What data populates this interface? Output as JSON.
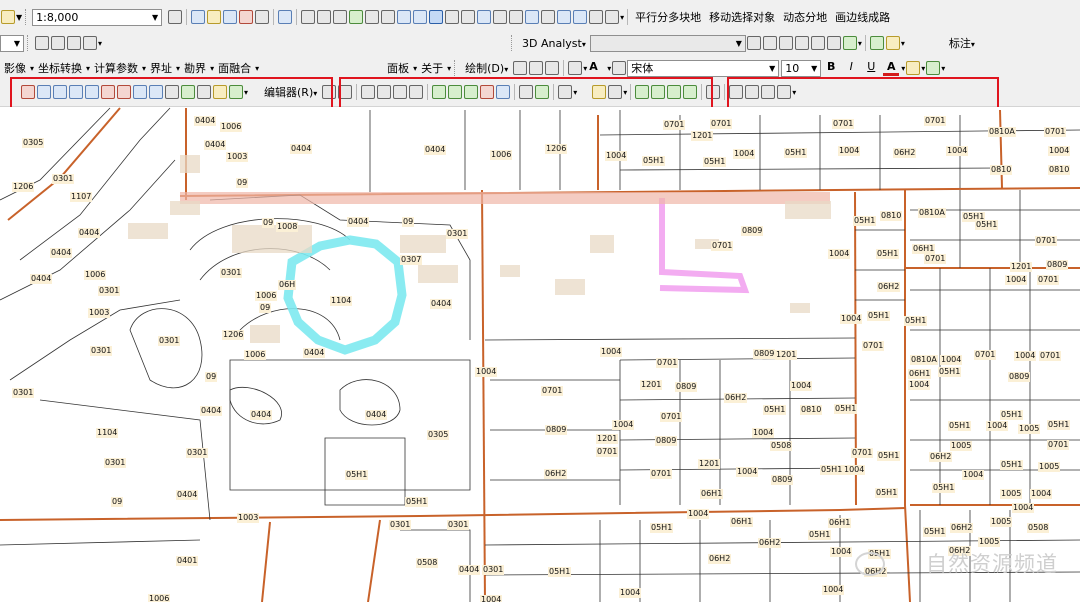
{
  "toolbar1": {
    "scale_value": "1:8,000",
    "right_items": [
      "平行分多块地",
      "移动选择对象",
      "动态分地",
      "画边线成路"
    ]
  },
  "toolbar2": {
    "analyst_label": "3D Analyst",
    "annotation_label": "标注"
  },
  "toolbar3": {
    "menus": [
      "影像",
      "坐标转换",
      "计算参数",
      "界址",
      "勘界",
      "面融合"
    ],
    "menus_right": [
      "面板",
      "关于"
    ],
    "draw_label": "绘制(D)",
    "font_name": "宋体",
    "font_size": "10",
    "bold": "B",
    "italic": "I",
    "underline": "U",
    "font_color": "A"
  },
  "toolbar4": {
    "editor_label": "编辑器(R)"
  },
  "map": {
    "labels": [
      [
        "0305",
        22,
        138
      ],
      [
        "0301",
        52,
        174
      ],
      [
        "1206",
        12,
        182
      ],
      [
        "1107",
        70,
        192
      ],
      [
        "0404",
        78,
        228
      ],
      [
        "0404",
        50,
        248
      ],
      [
        "1006",
        84,
        270
      ],
      [
        "0404",
        30,
        274
      ],
      [
        "0301",
        98,
        286
      ],
      [
        "1003",
        88,
        308
      ],
      [
        "0301",
        158,
        336
      ],
      [
        "0301",
        90,
        346
      ],
      [
        "1206",
        222,
        330
      ],
      [
        "1006",
        244,
        350
      ],
      [
        "0301",
        12,
        388
      ],
      [
        "09",
        205,
        372
      ],
      [
        "0404",
        200,
        406
      ],
      [
        "0404",
        250,
        410
      ],
      [
        "1104",
        96,
        428
      ],
      [
        "0301",
        104,
        458
      ],
      [
        "0301",
        186,
        448
      ],
      [
        "0404",
        176,
        490
      ],
      [
        "09",
        111,
        497
      ],
      [
        "1003",
        237,
        513
      ],
      [
        "1006",
        148,
        594
      ],
      [
        "0401",
        176,
        556
      ],
      [
        "0404",
        194,
        116
      ],
      [
        "1006",
        220,
        122
      ],
      [
        "0404",
        204,
        140
      ],
      [
        "1003",
        226,
        152
      ],
      [
        "09",
        236,
        178
      ],
      [
        "0404",
        290,
        144
      ],
      [
        "09",
        262,
        218
      ],
      [
        "1008",
        276,
        222
      ],
      [
        "0404",
        347,
        217
      ],
      [
        "09",
        402,
        217
      ],
      [
        "0301",
        446,
        229
      ],
      [
        "0307",
        400,
        255
      ],
      [
        "0301",
        220,
        268
      ],
      [
        "06H",
        278,
        280
      ],
      [
        "1006",
        255,
        291
      ],
      [
        "09",
        259,
        303
      ],
      [
        "1104",
        330,
        296
      ],
      [
        "0404",
        430,
        299
      ],
      [
        "0404",
        303,
        348
      ],
      [
        "0404",
        365,
        410
      ],
      [
        "0305",
        427,
        430
      ],
      [
        "05H1",
        345,
        470
      ],
      [
        "05H1",
        405,
        497
      ],
      [
        "0301",
        389,
        520
      ],
      [
        "0301",
        447,
        520
      ],
      [
        "0508",
        416,
        558
      ],
      [
        "0404",
        458,
        565
      ],
      [
        "0301",
        482,
        565
      ],
      [
        "1004",
        480,
        595
      ],
      [
        "0404",
        424,
        145
      ],
      [
        "1006",
        490,
        150
      ],
      [
        "1206",
        545,
        144
      ],
      [
        "1004",
        605,
        151
      ],
      [
        "05H1",
        642,
        156
      ],
      [
        "0701",
        663,
        120
      ],
      [
        "1201",
        691,
        131
      ],
      [
        "0701",
        710,
        119
      ],
      [
        "05H1",
        703,
        157
      ],
      [
        "1004",
        733,
        149
      ],
      [
        "05H1",
        784,
        148
      ],
      [
        "0701",
        832,
        119
      ],
      [
        "1004",
        838,
        146
      ],
      [
        "06H2",
        893,
        148
      ],
      [
        "0701",
        924,
        116
      ],
      [
        "1004",
        946,
        146
      ],
      [
        "0810A",
        988,
        127
      ],
      [
        "0701",
        1044,
        127
      ],
      [
        "0810",
        990,
        165
      ],
      [
        "1004",
        1048,
        146
      ],
      [
        "0810",
        1048,
        165
      ],
      [
        "1004",
        600,
        347
      ],
      [
        "0701",
        656,
        358
      ],
      [
        "1004",
        475,
        367
      ],
      [
        "1201",
        640,
        380
      ],
      [
        "0809",
        675,
        382
      ],
      [
        "1004",
        790,
        381
      ],
      [
        "0701",
        541,
        386
      ],
      [
        "06H2",
        724,
        393
      ],
      [
        "05H1",
        763,
        405
      ],
      [
        "0810",
        800,
        405
      ],
      [
        "05H1",
        834,
        404
      ],
      [
        "0701",
        660,
        412
      ],
      [
        "1004",
        612,
        420
      ],
      [
        "0809",
        545,
        425
      ],
      [
        "1201",
        596,
        434
      ],
      [
        "0701",
        596,
        447
      ],
      [
        "0809",
        655,
        436
      ],
      [
        "1004",
        752,
        428
      ],
      [
        "0508",
        770,
        441
      ],
      [
        "0701",
        851,
        448
      ],
      [
        "1004",
        736,
        467
      ],
      [
        "05H1",
        820,
        465
      ],
      [
        "1004",
        843,
        465
      ],
      [
        "05H1",
        877,
        451
      ],
      [
        "1201",
        698,
        459
      ],
      [
        "0701",
        650,
        469
      ],
      [
        "0809",
        771,
        475
      ],
      [
        "06H2",
        544,
        469
      ],
      [
        "06H1",
        700,
        489
      ],
      [
        "05H1",
        875,
        488
      ],
      [
        "0809",
        741,
        226
      ],
      [
        "0701",
        711,
        241
      ],
      [
        "05H1",
        853,
        216
      ],
      [
        "0810",
        880,
        211
      ],
      [
        "0810A",
        918,
        208
      ],
      [
        "05H1",
        962,
        212
      ],
      [
        "05H1",
        975,
        220
      ],
      [
        "06H1",
        912,
        244
      ],
      [
        "0701",
        924,
        254
      ],
      [
        "1004",
        828,
        249
      ],
      [
        "05H1",
        876,
        249
      ],
      [
        "1201",
        1010,
        262
      ],
      [
        "1004",
        1005,
        275
      ],
      [
        "0701",
        1037,
        275
      ],
      [
        "0701",
        1035,
        236
      ],
      [
        "0809",
        1046,
        260
      ],
      [
        "06H2",
        877,
        282
      ],
      [
        "05H1",
        867,
        311
      ],
      [
        "1004",
        840,
        314
      ],
      [
        "05H1",
        904,
        316
      ],
      [
        "0701",
        862,
        341
      ],
      [
        "0809",
        753,
        349
      ],
      [
        "1201",
        775,
        350
      ],
      [
        "0810A",
        910,
        355
      ],
      [
        "1004",
        940,
        355
      ],
      [
        "06H1",
        908,
        369
      ],
      [
        "05H1",
        938,
        367
      ],
      [
        "0701",
        974,
        350
      ],
      [
        "1004",
        1014,
        351
      ],
      [
        "0701",
        1039,
        351
      ],
      [
        "0809",
        1008,
        372
      ],
      [
        "1004",
        908,
        380
      ],
      [
        "05H1",
        1000,
        410
      ],
      [
        "05H1",
        948,
        421
      ],
      [
        "1004",
        986,
        421
      ],
      [
        "05H1",
        1047,
        420
      ],
      [
        "1005",
        1018,
        424
      ],
      [
        "1005",
        950,
        441
      ],
      [
        "0701",
        1047,
        440
      ],
      [
        "06H2",
        929,
        452
      ],
      [
        "05H1",
        1000,
        460
      ],
      [
        "05H1",
        932,
        483
      ],
      [
        "1004",
        962,
        470
      ],
      [
        "1005",
        1000,
        489
      ],
      [
        "1004",
        1030,
        489
      ],
      [
        "1004",
        1012,
        503
      ],
      [
        "1005",
        1038,
        462
      ],
      [
        "05H1",
        650,
        523
      ],
      [
        "06H1",
        730,
        517
      ],
      [
        "1004",
        687,
        509
      ],
      [
        "06H1",
        828,
        518
      ],
      [
        "05H1",
        808,
        530
      ],
      [
        "06H2",
        758,
        538
      ],
      [
        "05H1",
        868,
        549
      ],
      [
        "06H2",
        708,
        554
      ],
      [
        "1004",
        830,
        547
      ],
      [
        "06H2",
        864,
        567
      ],
      [
        "05H1",
        548,
        567
      ],
      [
        "1004",
        619,
        588
      ],
      [
        "1004",
        822,
        585
      ],
      [
        "06H2",
        950,
        523
      ],
      [
        "05H1",
        923,
        527
      ],
      [
        "1005",
        978,
        537
      ],
      [
        "0508",
        1027,
        523
      ],
      [
        "1005",
        990,
        517
      ],
      [
        "06H2",
        948,
        546
      ]
    ]
  }
}
